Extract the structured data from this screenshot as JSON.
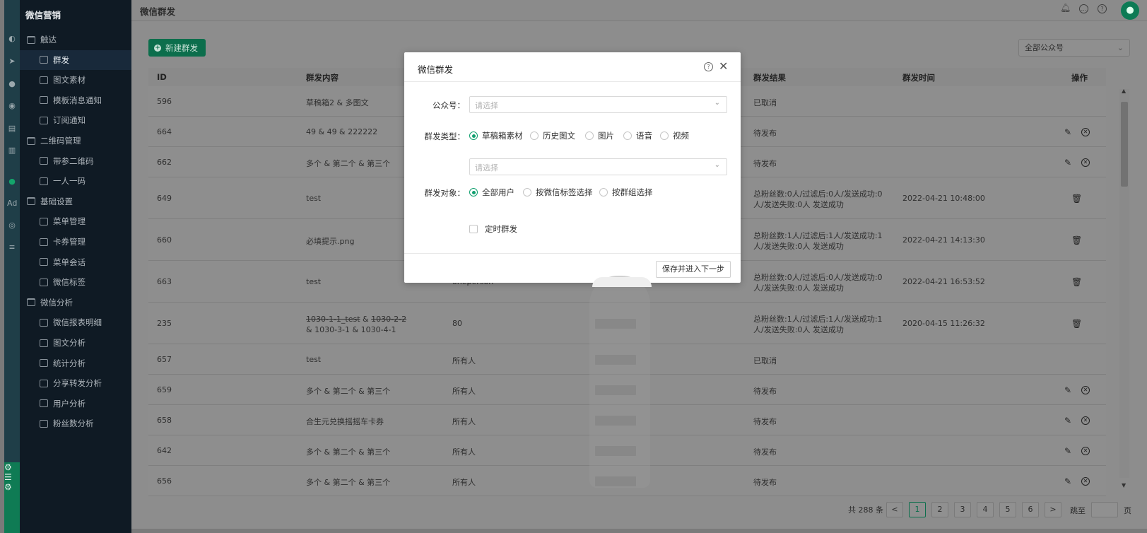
{
  "sidebar": {
    "title": "微信营销",
    "items": [
      {
        "label": "触达",
        "kind": "group",
        "icon": "folder-icon"
      },
      {
        "label": "群发",
        "kind": "child",
        "icon": "send-icon",
        "active": true
      },
      {
        "label": "图文素材",
        "kind": "child",
        "icon": "document-icon"
      },
      {
        "label": "模板消息通知",
        "kind": "child",
        "icon": "template-icon"
      },
      {
        "label": "订阅通知",
        "kind": "child",
        "icon": "subscription-icon"
      },
      {
        "label": "二维码管理",
        "kind": "group",
        "icon": "folder-icon"
      },
      {
        "label": "带参二维码",
        "kind": "child",
        "icon": "qrcode-icon"
      },
      {
        "label": "一人一码",
        "kind": "child",
        "icon": "qrcode-icon"
      },
      {
        "label": "基础设置",
        "kind": "group",
        "icon": "folder-icon"
      },
      {
        "label": "菜单管理",
        "kind": "child",
        "icon": "menu-icon"
      },
      {
        "label": "卡券管理",
        "kind": "child",
        "icon": "coupon-icon"
      },
      {
        "label": "菜单会话",
        "kind": "child",
        "icon": "chat-icon"
      },
      {
        "label": "微信标签",
        "kind": "child",
        "icon": "tag-icon"
      },
      {
        "label": "微信分析",
        "kind": "group",
        "icon": "folder-icon"
      },
      {
        "label": "微信报表明细",
        "kind": "child",
        "icon": "report-icon"
      },
      {
        "label": "图文分析",
        "kind": "child",
        "icon": "document-icon"
      },
      {
        "label": "统计分析",
        "kind": "child",
        "icon": "stats-icon"
      },
      {
        "label": "分享转发分析",
        "kind": "child",
        "icon": "share-icon"
      },
      {
        "label": "用户分析",
        "kind": "child",
        "icon": "user-scan-icon"
      },
      {
        "label": "粉丝数分析",
        "kind": "child",
        "icon": "thumbs-up-icon"
      }
    ]
  },
  "header": {
    "title": "微信群发"
  },
  "toolbar": {
    "new_button": "新建群发",
    "account_select": "全部公众号"
  },
  "table": {
    "columns": [
      "ID",
      "群发内容",
      "群发结果",
      "群发时间",
      "操作"
    ],
    "rows": [
      {
        "id": "596",
        "content": "草稿箱2 & 多图文",
        "target": "",
        "result": "已取消",
        "time": "",
        "actions": []
      },
      {
        "id": "664",
        "content": "49 & 49 & 222222",
        "target": "",
        "result": "待发布",
        "time": "",
        "actions": [
          "edit",
          "cancel"
        ]
      },
      {
        "id": "662",
        "content": "多个 & 第二个 & 第三个",
        "target": "",
        "result": "待发布",
        "time": "",
        "actions": [
          "edit",
          "cancel"
        ]
      },
      {
        "id": "649",
        "content": "test",
        "target": "",
        "result": "总粉丝数:0人/过滤后:0人/发送成功:0人/发送失败:0人 发送成功",
        "time": "2022-04-21 10:48:00",
        "actions": [
          "delete"
        ]
      },
      {
        "id": "660",
        "content": "必填提示.png",
        "target": "",
        "result": "总粉丝数:1人/过滤后:1人/发送成功:1人/发送失败:0人 发送成功",
        "time": "2022-04-21 14:13:30",
        "actions": [
          "delete"
        ]
      },
      {
        "id": "663",
        "content": "test",
        "target": "oneperson",
        "result": "总粉丝数:0人/过滤后:0人/发送成功:0人/发送失败:0人 发送成功",
        "time": "2022-04-21 16:53:52",
        "actions": [
          "delete"
        ]
      },
      {
        "id": "235",
        "content_strike": "1030-1-1_test",
        "content_strike2": "1030-2-2",
        "content_rest": "& 1030-3-1 & 1030-4-1",
        "target": "80",
        "result": "总粉丝数:1人/过滤后:1人/发送成功:1人/发送失败:0人 发送成功",
        "time": "2020-04-15 11:26:32",
        "actions": [
          "delete"
        ]
      },
      {
        "id": "657",
        "content": "test",
        "target": "所有人",
        "result": "已取消",
        "time": "",
        "actions": []
      },
      {
        "id": "659",
        "content": "多个 & 第二个 & 第三个",
        "target": "所有人",
        "result": "待发布",
        "time": "",
        "actions": [
          "edit",
          "cancel"
        ]
      },
      {
        "id": "658",
        "content": "合生元兑换摇摇车卡券",
        "target": "所有人",
        "result": "待发布",
        "time": "",
        "actions": [
          "edit",
          "cancel"
        ]
      },
      {
        "id": "642",
        "content": "多个 & 第二个 & 第三个",
        "target": "所有人",
        "result": "待发布",
        "time": "",
        "actions": [
          "edit",
          "cancel"
        ]
      },
      {
        "id": "656",
        "content": "多个 & 第二个 & 第三个",
        "target": "所有人",
        "result": "待发布",
        "time": "",
        "actions": [
          "edit",
          "cancel"
        ]
      }
    ]
  },
  "pagination": {
    "total": "共 288 条",
    "prev": "<",
    "pages": [
      "1",
      "2",
      "3",
      "4",
      "5",
      "6"
    ],
    "next": ">",
    "jump_label": "跳至",
    "page_unit": "页"
  },
  "modal": {
    "title": "微信群发",
    "account_label": "公众号：",
    "account_placeholder": "请选择",
    "type_label": "群发类型：",
    "type_options": [
      "草稿箱素材",
      "历史图文",
      "图片",
      "语音",
      "视频"
    ],
    "type_selected": "草稿箱素材",
    "material_placeholder": "请选择",
    "target_label": "群发对象：",
    "target_options": [
      "全部用户",
      "按微信标签选择",
      "按群组选择"
    ],
    "target_selected": "全部用户",
    "schedule_label": "定时群发",
    "next_button": "保存并进入下一步"
  },
  "colors": {
    "brand": "#0c6e4c",
    "radio_checked": "#0f9f6e",
    "sidebar_bg": "#0f1a24"
  }
}
